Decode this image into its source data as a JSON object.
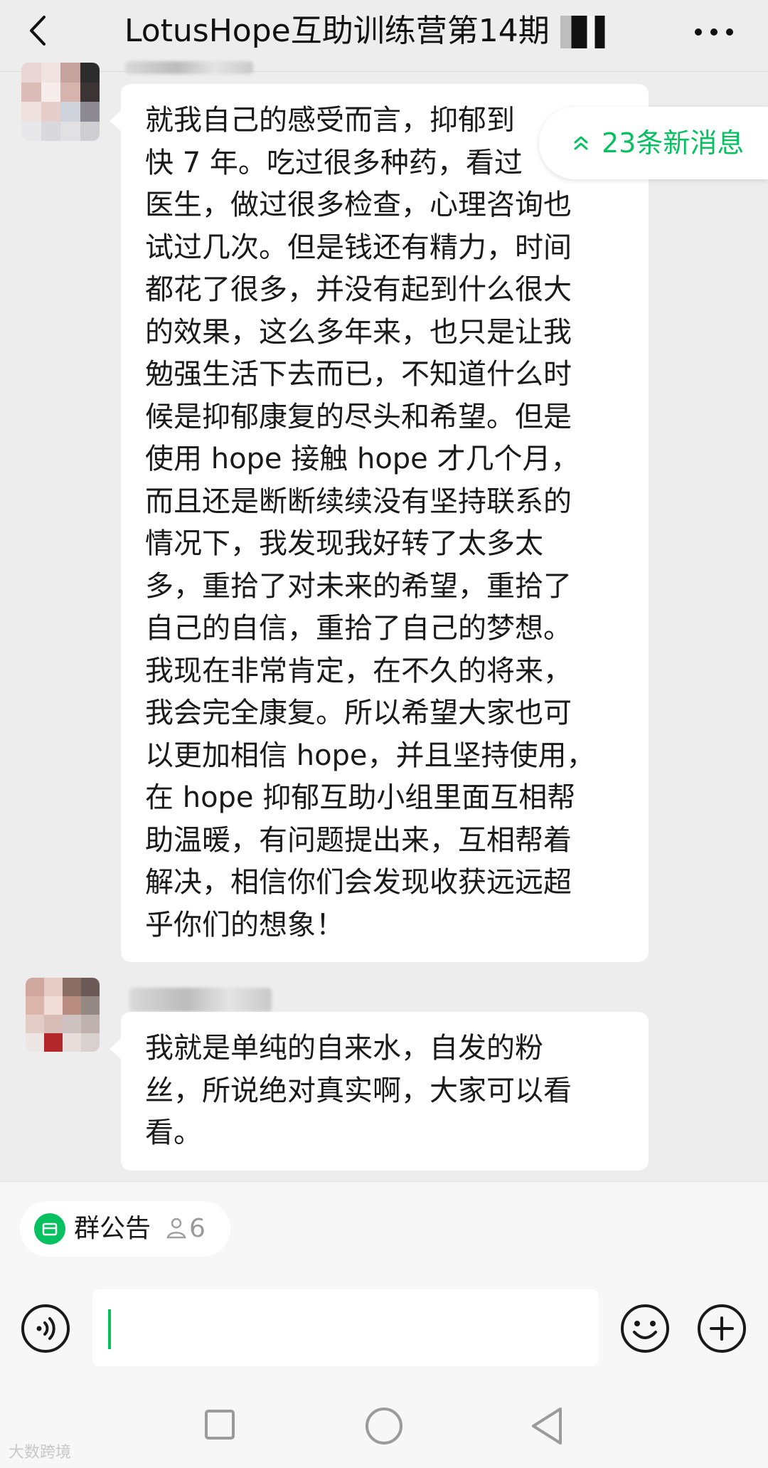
{
  "header": {
    "title": "LotusHope互助训练营第14期",
    "back_icon": "chevron-left-icon",
    "more_icon": "more-dots-icon"
  },
  "new_messages": {
    "label": "23条新消息",
    "icon": "double-chevron-up-icon",
    "color": "#07c160"
  },
  "messages": [
    {
      "lines": [
        "就我自己的感受而言，抑郁到",
        "快 7 年。吃过很多种药，看过",
        "医生，做过很多检查，心理咨询也",
        "试过几次。但是钱还有精力，时间",
        "都花了很多，并没有起到什么很大",
        "的效果，这么多年来，也只是让我",
        "勉强生活下去而已，不知道什么时",
        "候是抑郁康复的尽头和希望。但是",
        "使用 hope 接触 hope 才几个月，",
        "而且还是断断续续没有坚持联系的",
        "情况下，我发现我好转了太多太",
        "多，重拾了对未来的希望，重拾了",
        "自己的自信，重拾了自己的梦想。",
        "我现在非常肯定，在不久的将来，",
        "我会完全康复。所以希望大家也可",
        "以更加相信 hope，并且坚持使用，",
        "在 hope 抑郁互助小组里面互相帮",
        "助温暖，有问题提出来，互相帮着",
        "解决，相信你们会发现收获远远超",
        "乎你们的想象！"
      ]
    },
    {
      "lines": [
        "我就是单纯的自来水，自发的粉",
        "丝，所说绝对真实啊，大家可以看",
        "看。"
      ]
    }
  ],
  "announcement": {
    "label": "群公告",
    "count": "6",
    "icon": "announcement-icon",
    "count_icon": "person-icon"
  },
  "input_bar": {
    "voice_icon": "voice-icon",
    "emoji_icon": "emoji-icon",
    "plus_icon": "plus-icon",
    "value": ""
  },
  "nav": {
    "recents_icon": "square-icon",
    "home_icon": "circle-icon",
    "back_icon": "triangle-back-icon"
  },
  "watermark": "大数跨境"
}
